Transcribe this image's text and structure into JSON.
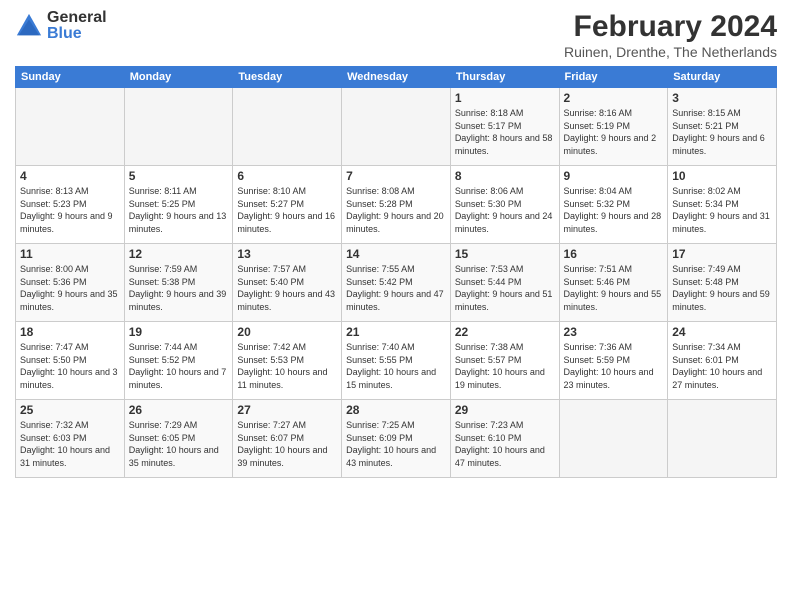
{
  "logo": {
    "general": "General",
    "blue": "Blue"
  },
  "calendar": {
    "title": "February 2024",
    "subtitle": "Ruinen, Drenthe, The Netherlands",
    "headers": [
      "Sunday",
      "Monday",
      "Tuesday",
      "Wednesday",
      "Thursday",
      "Friday",
      "Saturday"
    ],
    "weeks": [
      [
        {
          "day": "",
          "sunrise": "",
          "sunset": "",
          "daylight": ""
        },
        {
          "day": "",
          "sunrise": "",
          "sunset": "",
          "daylight": ""
        },
        {
          "day": "",
          "sunrise": "",
          "sunset": "",
          "daylight": ""
        },
        {
          "day": "",
          "sunrise": "",
          "sunset": "",
          "daylight": ""
        },
        {
          "day": "1",
          "sunrise": "Sunrise: 8:18 AM",
          "sunset": "Sunset: 5:17 PM",
          "daylight": "Daylight: 8 hours and 58 minutes."
        },
        {
          "day": "2",
          "sunrise": "Sunrise: 8:16 AM",
          "sunset": "Sunset: 5:19 PM",
          "daylight": "Daylight: 9 hours and 2 minutes."
        },
        {
          "day": "3",
          "sunrise": "Sunrise: 8:15 AM",
          "sunset": "Sunset: 5:21 PM",
          "daylight": "Daylight: 9 hours and 6 minutes."
        }
      ],
      [
        {
          "day": "4",
          "sunrise": "Sunrise: 8:13 AM",
          "sunset": "Sunset: 5:23 PM",
          "daylight": "Daylight: 9 hours and 9 minutes."
        },
        {
          "day": "5",
          "sunrise": "Sunrise: 8:11 AM",
          "sunset": "Sunset: 5:25 PM",
          "daylight": "Daylight: 9 hours and 13 minutes."
        },
        {
          "day": "6",
          "sunrise": "Sunrise: 8:10 AM",
          "sunset": "Sunset: 5:27 PM",
          "daylight": "Daylight: 9 hours and 16 minutes."
        },
        {
          "day": "7",
          "sunrise": "Sunrise: 8:08 AM",
          "sunset": "Sunset: 5:28 PM",
          "daylight": "Daylight: 9 hours and 20 minutes."
        },
        {
          "day": "8",
          "sunrise": "Sunrise: 8:06 AM",
          "sunset": "Sunset: 5:30 PM",
          "daylight": "Daylight: 9 hours and 24 minutes."
        },
        {
          "day": "9",
          "sunrise": "Sunrise: 8:04 AM",
          "sunset": "Sunset: 5:32 PM",
          "daylight": "Daylight: 9 hours and 28 minutes."
        },
        {
          "day": "10",
          "sunrise": "Sunrise: 8:02 AM",
          "sunset": "Sunset: 5:34 PM",
          "daylight": "Daylight: 9 hours and 31 minutes."
        }
      ],
      [
        {
          "day": "11",
          "sunrise": "Sunrise: 8:00 AM",
          "sunset": "Sunset: 5:36 PM",
          "daylight": "Daylight: 9 hours and 35 minutes."
        },
        {
          "day": "12",
          "sunrise": "Sunrise: 7:59 AM",
          "sunset": "Sunset: 5:38 PM",
          "daylight": "Daylight: 9 hours and 39 minutes."
        },
        {
          "day": "13",
          "sunrise": "Sunrise: 7:57 AM",
          "sunset": "Sunset: 5:40 PM",
          "daylight": "Daylight: 9 hours and 43 minutes."
        },
        {
          "day": "14",
          "sunrise": "Sunrise: 7:55 AM",
          "sunset": "Sunset: 5:42 PM",
          "daylight": "Daylight: 9 hours and 47 minutes."
        },
        {
          "day": "15",
          "sunrise": "Sunrise: 7:53 AM",
          "sunset": "Sunset: 5:44 PM",
          "daylight": "Daylight: 9 hours and 51 minutes."
        },
        {
          "day": "16",
          "sunrise": "Sunrise: 7:51 AM",
          "sunset": "Sunset: 5:46 PM",
          "daylight": "Daylight: 9 hours and 55 minutes."
        },
        {
          "day": "17",
          "sunrise": "Sunrise: 7:49 AM",
          "sunset": "Sunset: 5:48 PM",
          "daylight": "Daylight: 9 hours and 59 minutes."
        }
      ],
      [
        {
          "day": "18",
          "sunrise": "Sunrise: 7:47 AM",
          "sunset": "Sunset: 5:50 PM",
          "daylight": "Daylight: 10 hours and 3 minutes."
        },
        {
          "day": "19",
          "sunrise": "Sunrise: 7:44 AM",
          "sunset": "Sunset: 5:52 PM",
          "daylight": "Daylight: 10 hours and 7 minutes."
        },
        {
          "day": "20",
          "sunrise": "Sunrise: 7:42 AM",
          "sunset": "Sunset: 5:53 PM",
          "daylight": "Daylight: 10 hours and 11 minutes."
        },
        {
          "day": "21",
          "sunrise": "Sunrise: 7:40 AM",
          "sunset": "Sunset: 5:55 PM",
          "daylight": "Daylight: 10 hours and 15 minutes."
        },
        {
          "day": "22",
          "sunrise": "Sunrise: 7:38 AM",
          "sunset": "Sunset: 5:57 PM",
          "daylight": "Daylight: 10 hours and 19 minutes."
        },
        {
          "day": "23",
          "sunrise": "Sunrise: 7:36 AM",
          "sunset": "Sunset: 5:59 PM",
          "daylight": "Daylight: 10 hours and 23 minutes."
        },
        {
          "day": "24",
          "sunrise": "Sunrise: 7:34 AM",
          "sunset": "Sunset: 6:01 PM",
          "daylight": "Daylight: 10 hours and 27 minutes."
        }
      ],
      [
        {
          "day": "25",
          "sunrise": "Sunrise: 7:32 AM",
          "sunset": "Sunset: 6:03 PM",
          "daylight": "Daylight: 10 hours and 31 minutes."
        },
        {
          "day": "26",
          "sunrise": "Sunrise: 7:29 AM",
          "sunset": "Sunset: 6:05 PM",
          "daylight": "Daylight: 10 hours and 35 minutes."
        },
        {
          "day": "27",
          "sunrise": "Sunrise: 7:27 AM",
          "sunset": "Sunset: 6:07 PM",
          "daylight": "Daylight: 10 hours and 39 minutes."
        },
        {
          "day": "28",
          "sunrise": "Sunrise: 7:25 AM",
          "sunset": "Sunset: 6:09 PM",
          "daylight": "Daylight: 10 hours and 43 minutes."
        },
        {
          "day": "29",
          "sunrise": "Sunrise: 7:23 AM",
          "sunset": "Sunset: 6:10 PM",
          "daylight": "Daylight: 10 hours and 47 minutes."
        },
        {
          "day": "",
          "sunrise": "",
          "sunset": "",
          "daylight": ""
        },
        {
          "day": "",
          "sunrise": "",
          "sunset": "",
          "daylight": ""
        }
      ]
    ]
  }
}
